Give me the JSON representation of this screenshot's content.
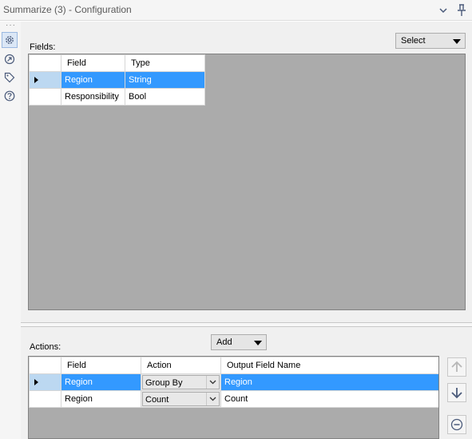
{
  "window": {
    "title": "Summarize (3) - Configuration"
  },
  "fields_section": {
    "label": "Fields:",
    "select_label": "Select",
    "columns": [
      "Field",
      "Type"
    ],
    "rows": [
      {
        "field": "Region",
        "type": "String",
        "selected": true
      },
      {
        "field": "Responsibility",
        "type": "Bool",
        "selected": false
      }
    ]
  },
  "actions_section": {
    "label": "Actions:",
    "add_label": "Add",
    "columns": [
      "Field",
      "Action",
      "Output Field Name"
    ],
    "rows": [
      {
        "field": "Region",
        "action": "Group By",
        "output": "Region",
        "selected": true
      },
      {
        "field": "Region",
        "action": "Count",
        "output": "Count",
        "selected": false
      }
    ]
  },
  "icons": {
    "collapse": "chevron-down-icon",
    "pin": "pin-icon",
    "configuration": "gear-icon",
    "annotation": "annotation-icon",
    "tag": "tag-icon",
    "help": "help-icon",
    "move_up": "arrow-up-icon",
    "move_down": "arrow-down-icon",
    "remove": "minus-circle-icon"
  },
  "colors": {
    "selection": "#3399ff",
    "row_header_selected": "#bcd8f1",
    "grid_background": "#ababab",
    "icon_blue": "#4a5a7a"
  }
}
